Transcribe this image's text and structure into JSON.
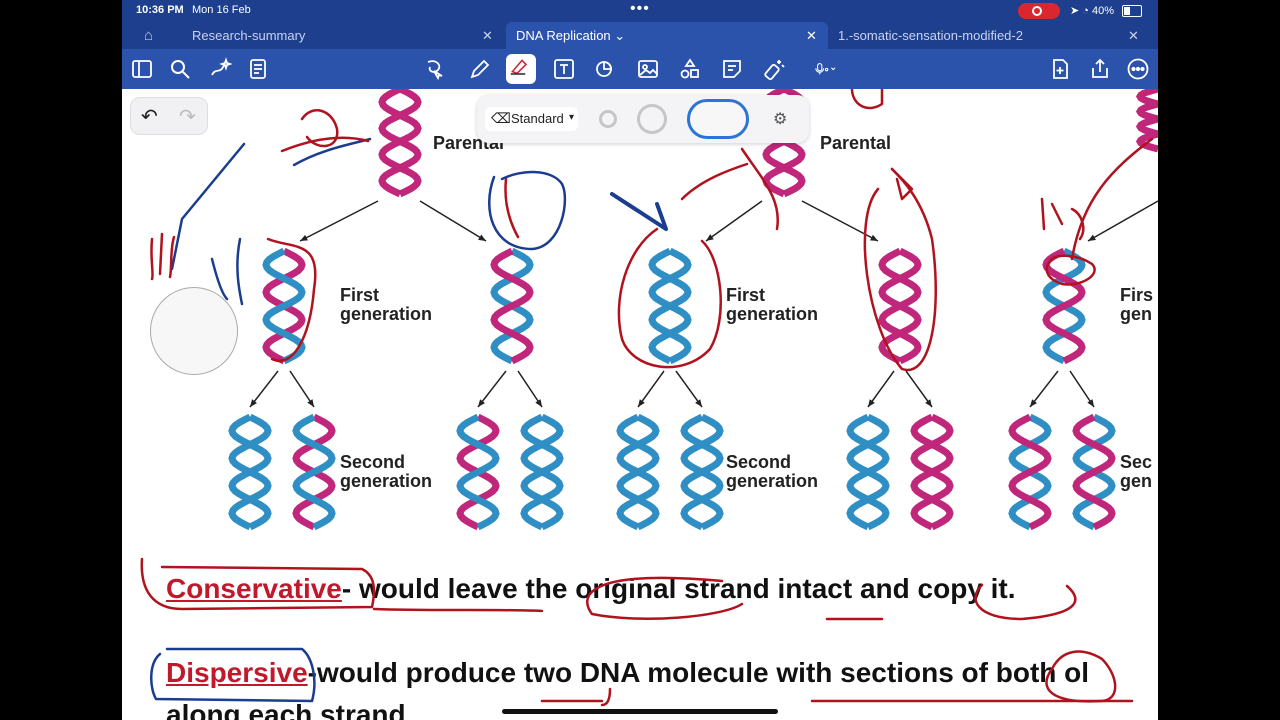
{
  "status_bar": {
    "time": "10:36 PM",
    "date": "Mon 16 Feb",
    "battery": "40%",
    "icons": [
      "recording-icon",
      "location-icon",
      "wifi-icon",
      "battery-icon"
    ]
  },
  "tabs": [
    {
      "label": "Research-summary",
      "active": false
    },
    {
      "label": "DNA Replication",
      "active": true
    },
    {
      "label": "1.-somatic-sensation-modified-2",
      "active": false
    }
  ],
  "toolbar": {
    "icons": [
      "sidebar-icon",
      "search-icon",
      "magic-icon",
      "notes-icon",
      "lasso-icon",
      "pen-icon",
      "eraser-icon",
      "text-icon",
      "shapes-icon",
      "image-icon",
      "elements-icon",
      "sticky-note-icon",
      "laser-icon",
      "microphone-icon",
      "add-page-icon",
      "share-icon",
      "more-icon"
    ]
  },
  "pen_tool": {
    "eraser_mode": "Standard"
  },
  "document": {
    "headings": [
      "Parental",
      "Parental"
    ],
    "first_generation": [
      "First",
      "generation",
      "First",
      "generation",
      "Firs",
      "gen"
    ],
    "second_generation": [
      "Second",
      "generation",
      "Second",
      "generation",
      "Sec",
      "gen"
    ],
    "sentences": {
      "conservative_term": "Conservative",
      "conservative_rest": "- would leave the original strand intact and copy it.",
      "dispersive_term": "Dispersive",
      "dispersive_rest": "-would produce two DNA molecule with sections of both ol",
      "line3": "along each strand"
    }
  },
  "colors": {
    "toolbar": "#2c53ac",
    "tabbar": "#1d3f8e",
    "ink_red": "#b0121e",
    "ink_blue": "#1a3d8f",
    "helix_blue": "#2f8fc4",
    "helix_pink": "#c0267a"
  }
}
